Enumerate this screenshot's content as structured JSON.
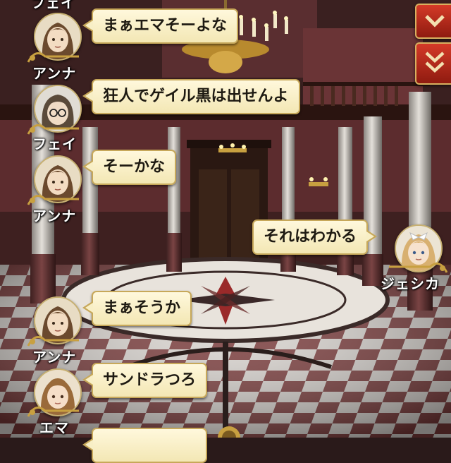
{
  "chat": {
    "messages": [
      {
        "speaker": "フェイ",
        "text": "まぁエマそーよな",
        "side": "left",
        "avatar": "anna-avatar",
        "speaker_shown": "アンナ"
      },
      {
        "speaker": "フェイ",
        "text": "狂人でゲイル黒は出せんよ",
        "side": "left"
      },
      {
        "speaker": "アンナ",
        "text": "そーかな",
        "side": "left"
      },
      {
        "speaker": "ジェシカ",
        "text": "それはわかる",
        "side": "right"
      },
      {
        "speaker": "アンナ",
        "text": "まぁそうか",
        "side": "left"
      },
      {
        "speaker": "エマ",
        "text": "サンドラつろ",
        "side": "left"
      }
    ],
    "top_partial_name": "フェイ",
    "speakers": {
      "anna": "アンナ",
      "fei": "フェイ",
      "jessica": "ジェシカ",
      "ema": "エマ"
    }
  },
  "controls": {
    "scroll_up_icon": "chevron-down-icon",
    "scroll_down_icon": "double-chevron-down-icon"
  },
  "colors": {
    "bubble_fill": "#f8efc6",
    "bubble_border": "#c7a85a",
    "button_red": "#c0301f",
    "floor_dark": "#7a3a3a"
  }
}
